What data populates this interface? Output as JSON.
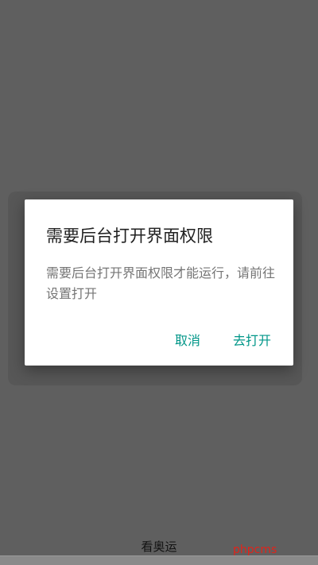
{
  "dialog": {
    "title": "需要后台打开界面权限",
    "message": "需要后台打开界面权限才能运行，请前往设置打开",
    "cancel_label": "取消",
    "confirm_label": "去打开"
  },
  "page": {
    "bottom_label": "看奥运"
  },
  "watermark": {
    "text": "phpcms"
  },
  "colors": {
    "scrim": "#5f5f5f",
    "dialog_bg": "#ffffff",
    "accent": "#009688",
    "watermark": "#e2231a"
  }
}
